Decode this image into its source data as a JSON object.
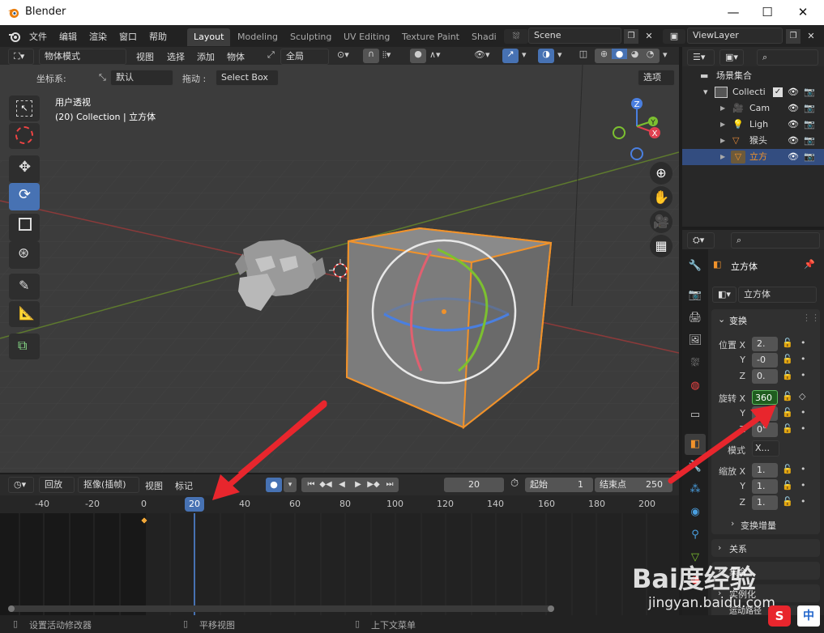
{
  "window": {
    "title": "Blender",
    "minimize": "—",
    "maximize": "☐",
    "close": "✕"
  },
  "menu": [
    "文件",
    "编辑",
    "渲染",
    "窗口",
    "帮助"
  ],
  "workspaces": [
    "Layout",
    "Modeling",
    "Sculpting",
    "UV Editing",
    "Texture Paint",
    "Shadi"
  ],
  "scene": {
    "name": "Scene"
  },
  "view_layer": {
    "name": "ViewLayer"
  },
  "viewport": {
    "mode": "物体模式",
    "menus": [
      "视图",
      "选择",
      "添加",
      "物体"
    ],
    "transform_orientation": "全局",
    "coord_label": "坐标系:",
    "coord_value": "默认",
    "drag_label": "拖动 :",
    "drag_value": "Select Box",
    "options": "选项",
    "overlay_title": "用户透视",
    "overlay_subtitle": "(20) Collection | 立方体",
    "gizmo_x": "X",
    "gizmo_y": "Y",
    "gizmo_z": "Z"
  },
  "outliner": {
    "root": "场景集合",
    "collection": "Collectic",
    "items": [
      "Cam",
      "Ligh",
      "猴头",
      "立方"
    ]
  },
  "properties": {
    "object_name": "立方体",
    "data_name": "立方体",
    "panel_transform": "变换",
    "location_label": "位置 X",
    "location": [
      "2.",
      "-0",
      "0."
    ],
    "rotation_label": "旋转 X",
    "rotation": [
      "360",
      "0°",
      "0°"
    ],
    "mode_label": "模式",
    "mode_value": "X...",
    "scale_label": "缩放 X",
    "scale": [
      "1.",
      "1.",
      "1."
    ],
    "axis_y": "Y",
    "axis_z": "Z",
    "delta_transform": "变换增量",
    "relations": "关系",
    "collections": "集合",
    "instancing": "实例化",
    "motion_paths": "运动路径"
  },
  "timeline": {
    "menus": [
      "回放",
      "抠像(插帧)",
      "视图",
      "标记"
    ],
    "current_frame": "20",
    "start_label": "起始",
    "start": "1",
    "end_label": "结束点",
    "end": "250",
    "ruler": [
      "-40",
      "-20",
      "0",
      "20",
      "40",
      "60",
      "80",
      "100",
      "120",
      "140",
      "160",
      "180",
      "200"
    ]
  },
  "statusbar": {
    "left": "设置活动修改器",
    "middle": "平移视图",
    "right": "上下文菜单"
  },
  "watermark": {
    "text": "Bai度经验",
    "url": "jingyan.baidu.com",
    "ime": "中"
  },
  "colors": {
    "accent": "#4772b3",
    "selected": "#e8892b",
    "arrow": "#e8262d"
  }
}
